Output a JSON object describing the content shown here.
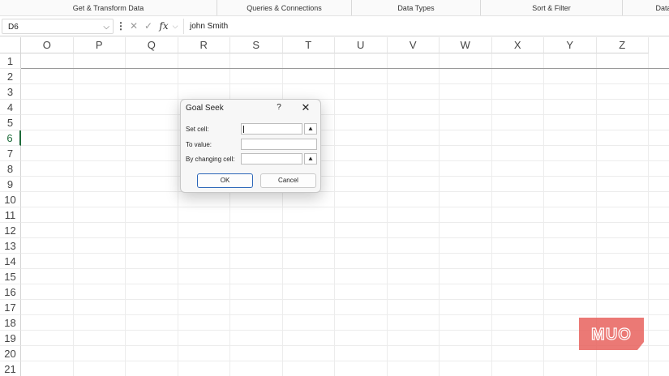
{
  "ribbon": {
    "groups": [
      {
        "label": "Get & Transform Data"
      },
      {
        "label": "Queries & Connections"
      },
      {
        "label": "Data Types"
      },
      {
        "label": "Sort & Filter"
      },
      {
        "label": "Data"
      }
    ]
  },
  "formula_bar": {
    "name_box": "D6",
    "cancel_icon": "close-icon",
    "enter_icon": "check-icon",
    "fx_label": "fx",
    "value": "john Smith"
  },
  "grid": {
    "columns": [
      "O",
      "P",
      "Q",
      "R",
      "S",
      "T",
      "U",
      "V",
      "W",
      "X",
      "Y",
      "Z"
    ],
    "rows": [
      "1",
      "2",
      "3",
      "4",
      "5",
      "6",
      "7",
      "8",
      "9",
      "10",
      "11",
      "12",
      "13",
      "14",
      "15",
      "16",
      "17",
      "18",
      "19",
      "20",
      "21"
    ],
    "selected_row": "6"
  },
  "dialog": {
    "title": "Goal Seek",
    "help": "?",
    "close": "✕",
    "set_cell_label": "Set cell:",
    "to_value_label": "To value:",
    "changing_cell_label": "By changing cell:",
    "set_cell_value": "",
    "to_value_value": "",
    "changing_cell_value": "",
    "ok_label": "OK",
    "cancel_label": "Cancel"
  },
  "watermark": {
    "text": "MUO",
    "color": "#e8615d"
  }
}
